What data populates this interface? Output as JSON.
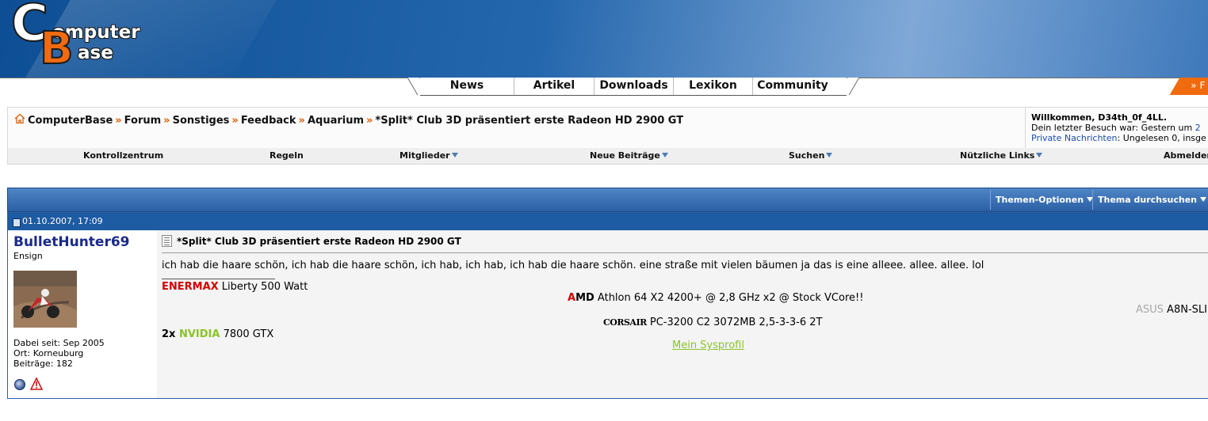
{
  "logo": {
    "line1": "C",
    "line2": "omputer",
    "line3": "B",
    "line4": "ase"
  },
  "nav": {
    "tabs": [
      "News",
      "Artikel",
      "Downloads",
      "Lexikon",
      "Community"
    ],
    "right_button": "» F"
  },
  "breadcrumb": [
    "ComputerBase",
    "Forum",
    "Sonstiges",
    "Feedback",
    "Aquarium",
    "*Split* Club 3D präsentiert erste Radeon HD 2900 GT"
  ],
  "breadcrumb_sep": "»",
  "welcome": {
    "greeting": "Willkommen, D34th_0f_4LL.",
    "last_visit": "Dein letzter Besuch war: Gestern um",
    "last_visit_time": "2",
    "pm_link": "Private Nachrichten",
    "pm_text": ": Ungelesen 0, insge"
  },
  "subnav": [
    "Kontrollzentrum",
    "Regeln",
    "Mitglieder",
    "Neue Beiträge",
    "Suchen",
    "Nützliche Links",
    "Abmelden"
  ],
  "thread_tools": {
    "options": "Themen-Optionen",
    "search": "Thema durchsuchen"
  },
  "post": {
    "date": "01.10.2007, 17:09",
    "username": "BulletHunter69",
    "usertitle": "Ensign",
    "joined": "Dabei seit: Sep 2005",
    "location": "Ort: Korneuburg",
    "posts": "Beiträge: 182",
    "title": "*Split* Club 3D präsentiert erste Radeon HD 2900 GT",
    "body": "ich hab die haare schön, ich hab die haare schön, ich hab, ich hab, ich hab die haare schön. eine straße mit vielen bäumen ja das is eine alleee. allee. allee. lol"
  },
  "signature": {
    "psu_brand": "ENERMAX",
    "psu": " Liberty 500 Watt",
    "cpu_a": "A",
    "cpu_md": "MD",
    "cpu": " Athlon 64 X2 4200+ @ 2,8 GHz x2 @ Stock VCore!!",
    "board_brand": "ASUS",
    "board": " A8N-SLI",
    "ram_brand": "CORSAIR",
    "ram": " PC-3200 C2 3072MB 2,5-3-3-6 2T",
    "gpu_count": "2x ",
    "gpu_brand": "NVIDIA",
    "gpu": " 7800 GTX",
    "sysprofil": "Mein Sysprofil"
  },
  "colors": {
    "header_blue": "#2567ad",
    "accent_orange": "#f06b0e",
    "post_head": "#1d5ba3",
    "link": "#1c4ea8"
  }
}
